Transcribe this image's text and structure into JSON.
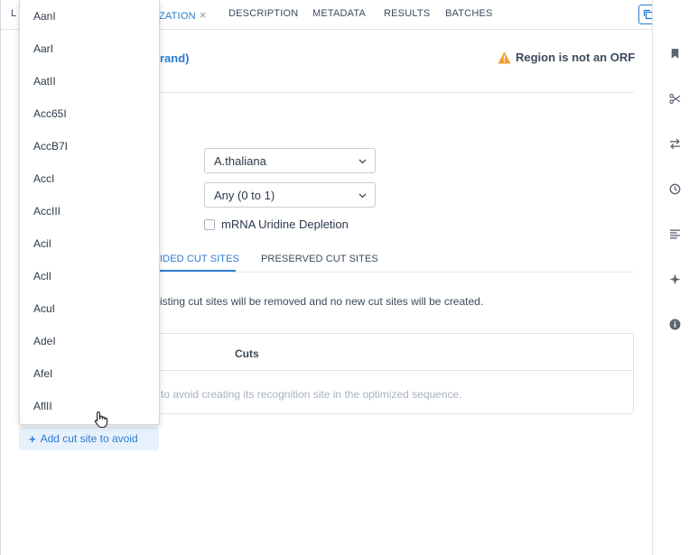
{
  "tabs": [
    {
      "label": "L",
      "active": false
    },
    {
      "label": "ZATION",
      "active": true,
      "close": "×"
    },
    {
      "label": "DESCRIPTION",
      "active": false
    },
    {
      "label": "METADATA",
      "active": false
    },
    {
      "label": "RESULTS",
      "active": false
    },
    {
      "label": "BATCHES",
      "active": false
    }
  ],
  "header": {
    "region_link": "rand)",
    "warning": "Region is not an ORF"
  },
  "form": {
    "organism": "A.thaliana",
    "range": "Any (0 to 1)",
    "checkbox_label": "mRNA Uridine Depletion"
  },
  "subtabs": {
    "avoided": "IDED CUT SITES",
    "preserved": "PRESERVED CUT SITES"
  },
  "info_text": "isting cut sites will be removed and no new cut sites will be created.",
  "table": {
    "column": "Cuts",
    "empty_text": "to avoid creating its recognition site in the optimized sequence."
  },
  "add_button": {
    "plus": "+",
    "label": "Add cut site to avoid"
  },
  "dropdown": {
    "items": [
      "AanI",
      "AarI",
      "AatII",
      "Acc65I",
      "AccB7I",
      "AccI",
      "AccIII",
      "AciI",
      "AclI",
      "AcuI",
      "AdeI",
      "AfeI",
      "AflII"
    ]
  },
  "colors": {
    "accent": "#2b7bd1",
    "warning": "#f39c28",
    "icon_gray": "#5b6673"
  },
  "icons": {
    "tabbar": [
      "copy-icon",
      "export-icon"
    ],
    "rail": [
      "bookmark-icon",
      "scissors-icon",
      "swap-icon",
      "history-icon",
      "align-left-icon",
      "sparkle-icon",
      "info-icon"
    ]
  }
}
